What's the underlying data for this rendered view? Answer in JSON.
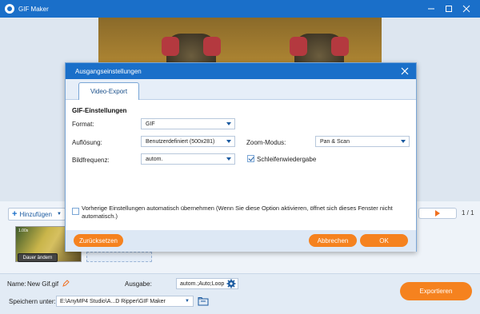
{
  "window": {
    "title": "GIF Maker"
  },
  "timeline": {
    "add_label": "Hinzufügen",
    "thumb_duration": "1.00s",
    "change_duration_label": "Dauer ändern",
    "page_indicator": "1 / 1"
  },
  "bottom": {
    "name_label": "Name:",
    "name_value": "New Gif.gif",
    "output_label": "Ausgabe:",
    "output_value": "autom.;Auto;Loop",
    "save_label": "Speichern unter:",
    "save_path": "E:\\AnyMP4 Studio\\A...D Ripper\\GIF Maker",
    "export_label": "Exportieren"
  },
  "dialog": {
    "title": "Ausgangseinstellungen",
    "tab": "Video-Export",
    "section": "GIF-Einstellungen",
    "format_label": "Format:",
    "format_value": "GIF",
    "resolution_label": "Auflösung:",
    "resolution_value": "Benutzerdefiniert (500x281)",
    "zoom_label": "Zoom-Modus:",
    "zoom_value": "Pan & Scan",
    "framerate_label": "Bildfrequenz:",
    "framerate_value": "autom.",
    "loop_label": "Schleifenwiedergabe",
    "loop_checked": true,
    "remember_text": "Vorherige Einstellungen automatisch übernehmen (Wenn Sie diese Option aktivieren, öffnet sich dieses Fenster nicht automatisch.)",
    "remember_checked": false,
    "reset_label": "Zurücksetzen",
    "cancel_label": "Abbrechen",
    "ok_label": "OK"
  }
}
